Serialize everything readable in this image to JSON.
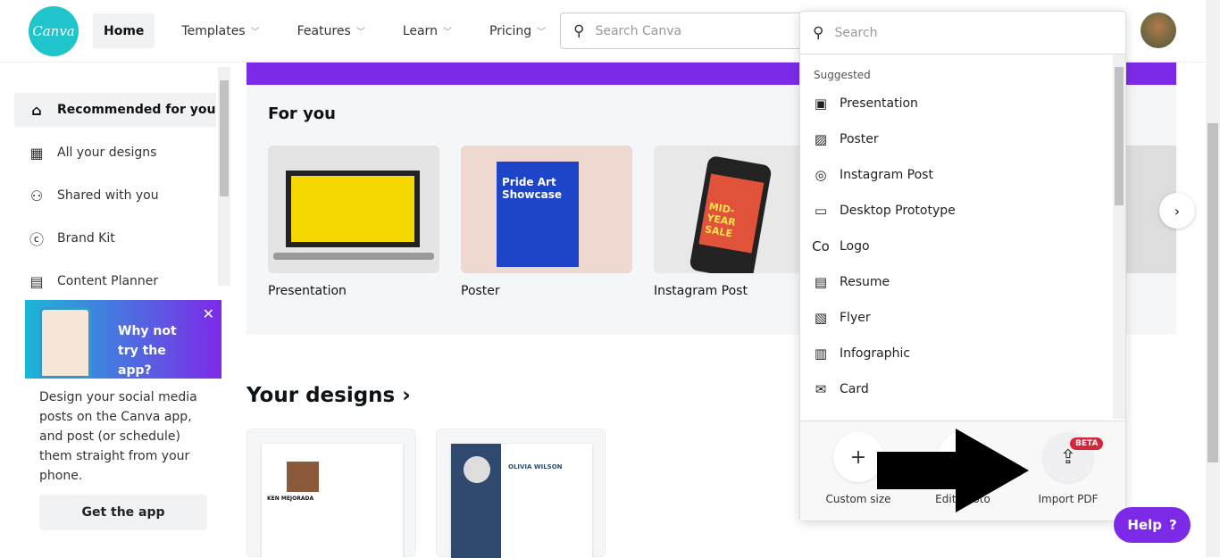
{
  "header": {
    "logo": "Canva",
    "nav": [
      {
        "label": "Home"
      },
      {
        "label": "Templates"
      },
      {
        "label": "Features"
      },
      {
        "label": "Learn"
      },
      {
        "label": "Pricing"
      }
    ],
    "search_placeholder": "Search Canva"
  },
  "sidebar": {
    "items": [
      {
        "label": "Recommended for you",
        "icon": "home-icon"
      },
      {
        "label": "All your designs",
        "icon": "grid-icon"
      },
      {
        "label": "Shared with you",
        "icon": "users-icon"
      },
      {
        "label": "Brand Kit",
        "icon": "brand-icon"
      },
      {
        "label": "Content Planner",
        "icon": "calendar-icon"
      }
    ]
  },
  "promo": {
    "title": "Why not try the app?",
    "body": "Design your social media posts on the Canva app, and post (or schedule) them straight from your phone.",
    "button": "Get the app"
  },
  "for_you": {
    "title": "For you",
    "cards": [
      {
        "label": "Presentation"
      },
      {
        "label": "Poster",
        "thumb_text": "Pride Art Showcase"
      },
      {
        "label": "Instagram Post",
        "thumb_text": "MID-YEAR SALE"
      }
    ]
  },
  "your_designs": {
    "title": "Your designs ›",
    "cards": [
      {
        "name": "KEN MEJORADA"
      },
      {
        "name": "OLIVIA WILSON"
      }
    ]
  },
  "dropdown": {
    "search_placeholder": "Search",
    "suggested_label": "Suggested",
    "options": [
      {
        "label": "Presentation",
        "icon": "▣"
      },
      {
        "label": "Poster",
        "icon": "▨"
      },
      {
        "label": "Instagram Post",
        "icon": "◎"
      },
      {
        "label": "Desktop Prototype",
        "icon": "▭"
      },
      {
        "label": "Logo",
        "icon": "Co"
      },
      {
        "label": "Resume",
        "icon": "▤"
      },
      {
        "label": "Flyer",
        "icon": "▧"
      },
      {
        "label": "Infographic",
        "icon": "▥"
      },
      {
        "label": "Card",
        "icon": "✉"
      }
    ],
    "actions": [
      {
        "label": "Custom size",
        "icon": "+"
      },
      {
        "label": "Edit photo",
        "icon": "✎"
      },
      {
        "label": "Import PDF",
        "icon": "⇪",
        "badge": "BETA"
      }
    ]
  },
  "help": {
    "label": "Help",
    "icon": "?"
  },
  "colors": {
    "brand": "#20c4cb",
    "accent": "#7d2ae8",
    "badge": "#d6263a"
  }
}
